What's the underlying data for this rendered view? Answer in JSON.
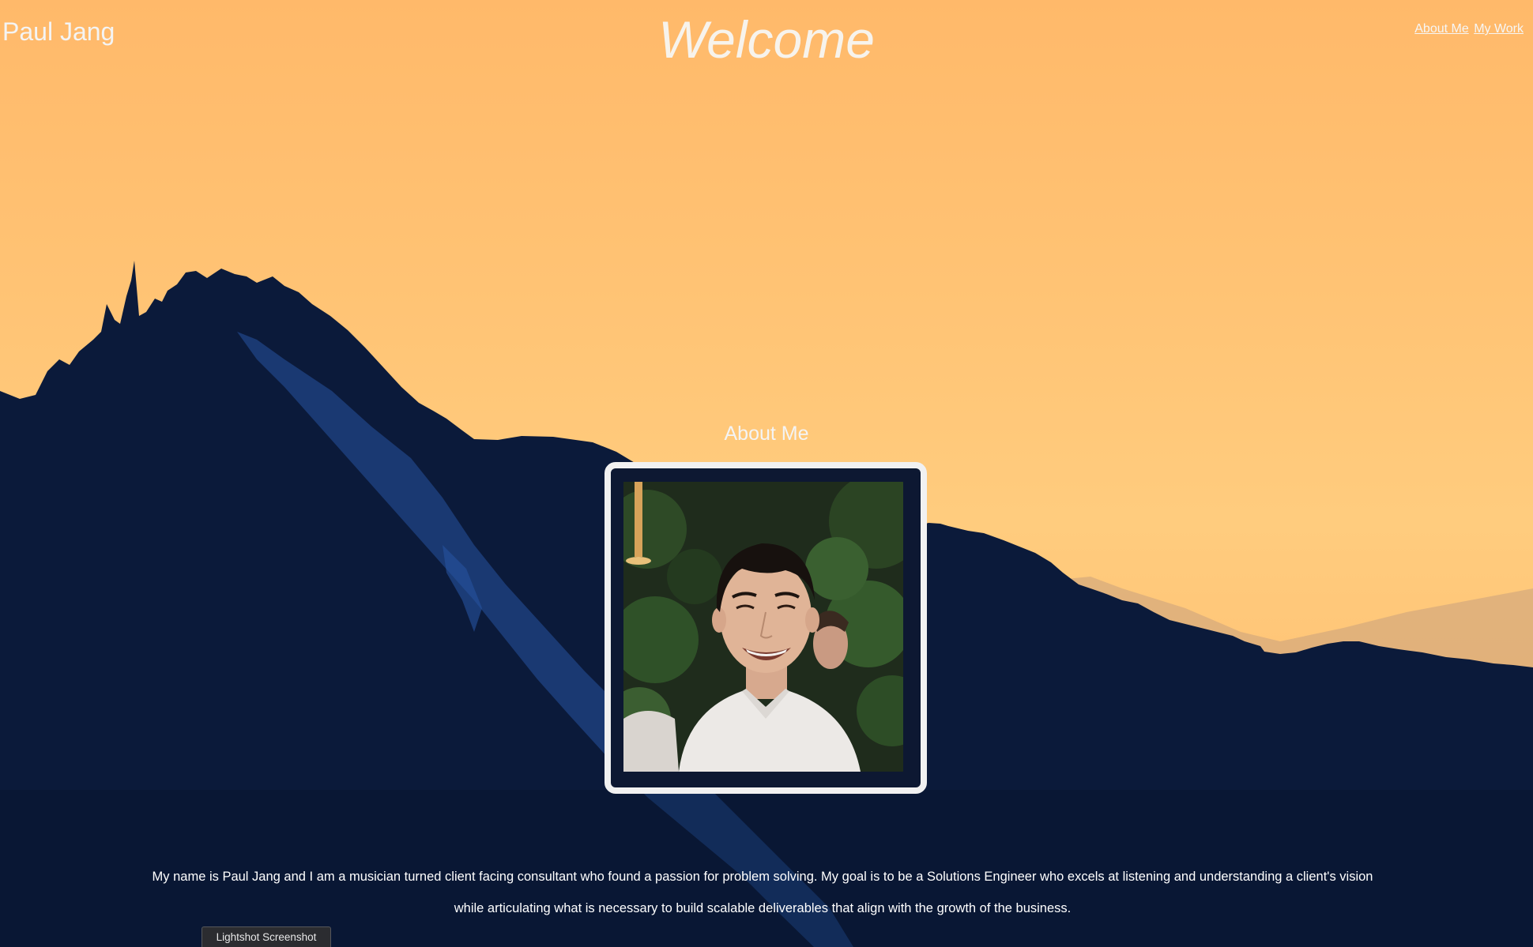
{
  "header": {
    "site_name": "Paul Jang",
    "welcome": "Welcome",
    "nav": [
      {
        "label": "About Me"
      },
      {
        "label": "My Work"
      }
    ]
  },
  "about": {
    "heading": "About Me",
    "bio": "My name is Paul Jang and I am a musician turned client facing consultant who found a passion for problem solving. My goal is to be a Solutions Engineer who excels at listening and understanding a client's vision while articulating what is necessary to build scalable deliverables that align with the growth of the business."
  },
  "overlay": {
    "lightshot_label": "Lightshot Screenshot"
  },
  "colors": {
    "sky": "#ffc374",
    "mountain": "#0b1a3a",
    "snow": "#1e4486",
    "text": "#f4f4f4"
  }
}
